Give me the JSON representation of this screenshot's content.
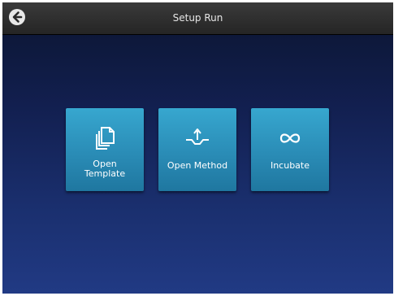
{
  "header": {
    "title": "Setup Run",
    "back_icon": "back-arrow-icon"
  },
  "tiles": [
    {
      "label_line1": "Open",
      "label_line2": "Template",
      "icon": "copy-documents-icon"
    },
    {
      "label": "Open Method",
      "icon": "open-method-icon"
    },
    {
      "label": "Incubate",
      "icon": "infinity-icon"
    }
  ],
  "colors": {
    "header_bg": "#2e2e2e",
    "background_top": "#0b1530",
    "background_bottom": "#213a84",
    "tile_top": "#37a7cf",
    "tile_bottom": "#1f77a0",
    "text": "#ffffff"
  }
}
